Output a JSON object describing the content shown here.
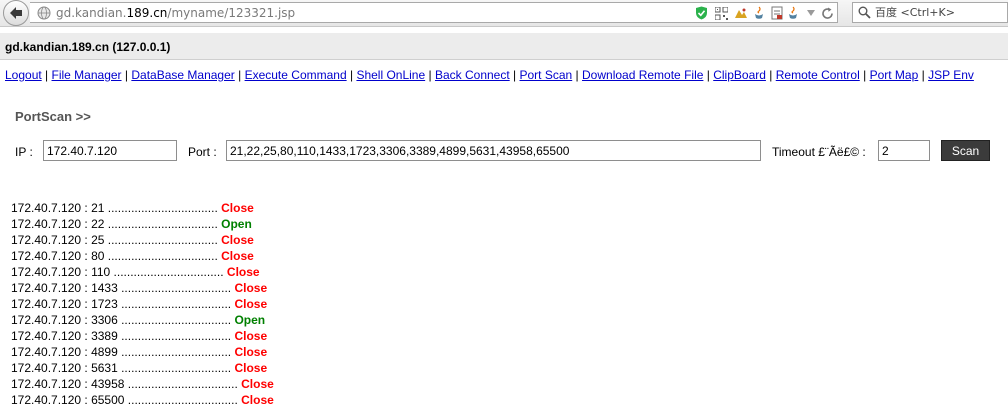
{
  "browser": {
    "url_prefix": "gd.kandian.",
    "url_domain": "189.cn",
    "url_path": "/myname/123321.jsp",
    "search_placeholder": "百度 <Ctrl+K>"
  },
  "header": {
    "host": "gd.kandian.189.cn (127.0.0.1)"
  },
  "nav": {
    "items": [
      "Logout",
      "File Manager",
      "DataBase Manager",
      "Execute Command",
      "Shell OnLine",
      "Back Connect",
      "Port Scan",
      "Download Remote File",
      "ClipBoard",
      "Remote Control",
      "Port Map",
      "JSP Env"
    ],
    "separator": "|"
  },
  "portscan": {
    "title": "PortScan >>",
    "ip_label": "IP :",
    "ip_value": "172.40.7.120",
    "port_label": "Port :",
    "port_value": "21,22,25,80,110,1433,1723,3306,3389,4899,5631,43958,65500",
    "timeout_label": "Timeout £¨Ãë£© :",
    "timeout_value": "2",
    "scan_label": "Scan"
  },
  "colors": {
    "close": "#ff0000",
    "open": "#008000",
    "link": "#0000cc"
  },
  "results": [
    {
      "prefix": "172.40.7.120 : 21 .................................",
      "status": "Close"
    },
    {
      "prefix": "172.40.7.120 : 22 .................................",
      "status": "Open"
    },
    {
      "prefix": "172.40.7.120 : 25 .................................",
      "status": "Close"
    },
    {
      "prefix": "172.40.7.120 : 80 .................................",
      "status": "Close"
    },
    {
      "prefix": "172.40.7.120 : 110 .................................",
      "status": "Close"
    },
    {
      "prefix": "172.40.7.120 : 1433 .................................",
      "status": "Close"
    },
    {
      "prefix": "172.40.7.120 : 1723 .................................",
      "status": "Close"
    },
    {
      "prefix": "172.40.7.120 : 3306 .................................",
      "status": "Open"
    },
    {
      "prefix": "172.40.7.120 : 3389 .................................",
      "status": "Close"
    },
    {
      "prefix": "172.40.7.120 : 4899 .................................",
      "status": "Close"
    },
    {
      "prefix": "172.40.7.120 : 5631 .................................",
      "status": "Close"
    },
    {
      "prefix": "172.40.7.120 : 43958 .................................",
      "status": "Close"
    },
    {
      "prefix": "172.40.7.120 : 65500 .................................",
      "status": "Close"
    }
  ]
}
